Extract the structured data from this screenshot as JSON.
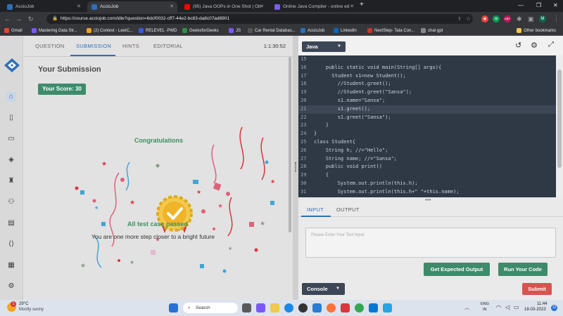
{
  "browser": {
    "tabs": [
      {
        "title": "AccioJob",
        "color": "#2f6fb5"
      },
      {
        "title": "AccioJob",
        "color": "#2f6fb5"
      },
      {
        "title": "(95) Java OOPs in One Shot | Ob",
        "color": "#ff0000"
      },
      {
        "title": "Online Java Compiler - online ed",
        "color": "#7a5af5"
      }
    ],
    "url": "https://course.acciojob.com/idle?question=6dcf0032-cff7-44e2-bc83-da8c07ad8901",
    "bookmarks": [
      "Gmail",
      "Mastering Data Str...",
      "(2) Contest - LeetC...",
      "RELEVEL -PWD",
      "GeeksforGeeks",
      "JS",
      "Car Rental Databas...",
      "AccioJob",
      "LinkedIn",
      "NextStep- Tata Con...",
      "chat gpt"
    ],
    "other_bookmarks": "Other bookmarks",
    "profile_initial": "M"
  },
  "problem_tabs": [
    "QUESTION",
    "SUBMISSION",
    "HINTS",
    "EDITORIAL"
  ],
  "timer": "1:1:30:52",
  "submission": {
    "title": "Your Submission",
    "score": "Your Score: 30",
    "congrats": "Congratulations",
    "passed": "All test case passed",
    "message": "You are one more step closer to a bright future"
  },
  "editor": {
    "language": "Java",
    "lines": [
      {
        "n": "15",
        "code": ""
      },
      {
        "n": "16",
        "code": "    public static void main(String[] args){"
      },
      {
        "n": "17",
        "code": "      Student s1=new Student();"
      },
      {
        "n": "18",
        "code": "        //Student.greet();"
      },
      {
        "n": "19",
        "code": "        //Student.greet(\"Sansa\");"
      },
      {
        "n": "20",
        "code": "        s1.name=\"Sansa\";"
      },
      {
        "n": "21",
        "code": "        s1.greet();"
      },
      {
        "n": "22",
        "code": "        s1.greet(\"Sansa\");"
      },
      {
        "n": "23",
        "code": "    }"
      },
      {
        "n": "24",
        "code": "}"
      },
      {
        "n": "25",
        "code": "class Student{"
      },
      {
        "n": "26",
        "code": "    String h; //=\"Hello\";"
      },
      {
        "n": "27",
        "code": "    String name; //=\"Sansa\";"
      },
      {
        "n": "28",
        "code": "    public void print()"
      },
      {
        "n": "29",
        "code": "    {"
      },
      {
        "n": "30",
        "code": "        System.out.println(this.h);"
      },
      {
        "n": "31",
        "code": "        System.out.println(this.h+\" \"+this.name);"
      }
    ]
  },
  "io": {
    "tabs": [
      "INPUT",
      "OUTPUT"
    ],
    "placeholder": "Please Enter Your Test Input",
    "expected_button": "Get Expected Output",
    "run_button": "Run Your Code",
    "console_button": "Console",
    "submit_button": "Submit"
  },
  "taskbar": {
    "weather_temp": "29°C",
    "weather_desc": "Mostly sunny",
    "search": "Search",
    "lang": "ENG",
    "region": "IN",
    "time": "11:44",
    "date": "18-03-2023",
    "notification_count": "1"
  },
  "colors": {
    "accent": "#2f6fb5",
    "green": "#3d8b6b",
    "red": "#d9534f",
    "editor_bg": "#2f3845"
  }
}
